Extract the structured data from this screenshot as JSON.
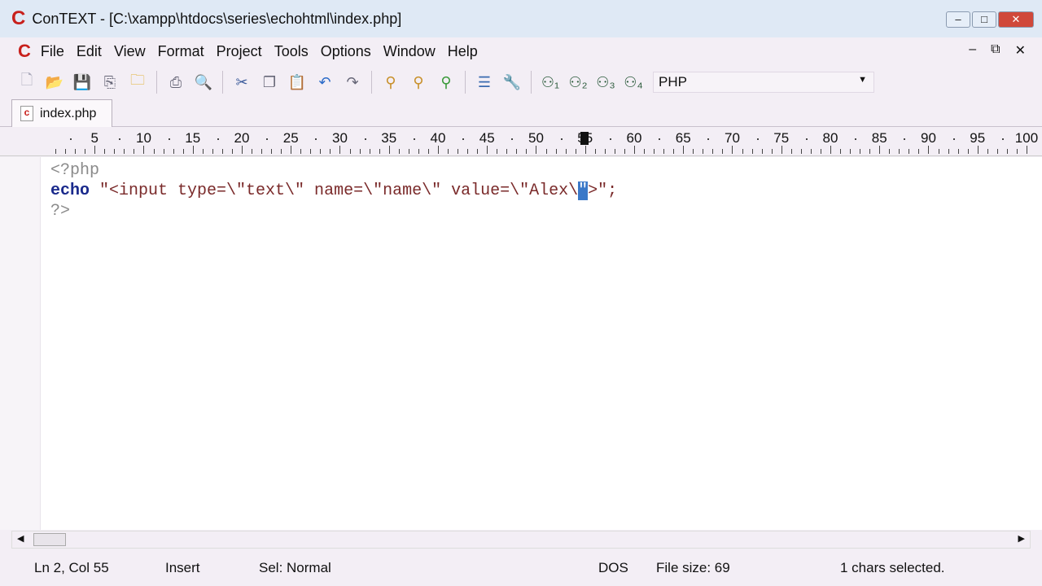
{
  "window": {
    "logo": "C",
    "title": "ConTEXT - [C:\\xampp\\htdocs\\series\\echohtml\\index.php]",
    "minimize": "–",
    "maximize": "□",
    "close": "✕"
  },
  "menu": {
    "items": [
      "File",
      "Edit",
      "View",
      "Format",
      "Project",
      "Tools",
      "Options",
      "Window",
      "Help"
    ],
    "mdi_controls": [
      "–",
      "⧉",
      "✕"
    ]
  },
  "toolbar": {
    "icons": [
      "new-file",
      "open",
      "save",
      "save-all",
      "open-folder",
      "|",
      "print",
      "print-preview",
      "|",
      "cut",
      "copy",
      "paste",
      "undo",
      "redo",
      "|",
      "find",
      "find-next",
      "replace",
      "|",
      "edit-list",
      "tools",
      "|",
      "user-1",
      "user-2",
      "user-3",
      "user-4"
    ],
    "language": "PHP"
  },
  "tab": {
    "label": "index.php"
  },
  "ruler": {
    "max_col": 100,
    "cursor_col": 55
  },
  "code": {
    "line1": "<?php",
    "line2_kw": "echo",
    "line2_a": " \"<input type=\\\"text\\\" name=\\\"name\\\" value=\\\"Alex\\",
    "line2_sel": "\"",
    "line2_b": ">\";",
    "line3": "?>"
  },
  "status": {
    "position": "Ln 2, Col 55",
    "mode": "Insert",
    "sel": "Sel: Normal",
    "eol": "DOS",
    "size": "File size: 69",
    "selected": "1 chars selected."
  }
}
